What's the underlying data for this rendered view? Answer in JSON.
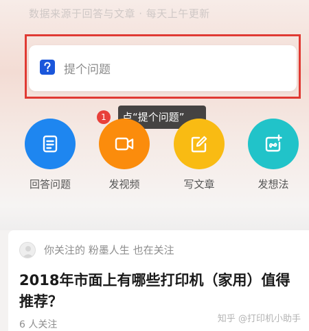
{
  "source_note": "数据来源于回答与文章 · 每天上午更新",
  "ask": {
    "placeholder": "提个问题",
    "icon": "question-mark-icon"
  },
  "callout": {
    "number": "1",
    "text": "点“提个问题”"
  },
  "actions": [
    {
      "label": "回答问题",
      "icon": "answer-doc-icon",
      "color": "#1e86f0"
    },
    {
      "label": "发视频",
      "icon": "video-camera-icon",
      "color": "#fb8c0c"
    },
    {
      "label": "写文章",
      "icon": "pencil-edit-icon",
      "color": "#f9bb13"
    },
    {
      "label": "发想法",
      "icon": "idea-add-icon",
      "color": "#21c3c9"
    }
  ],
  "feed_card": {
    "follow_prefix": "你关注的",
    "follow_user": "粉墨人生",
    "follow_suffix": "也在关注",
    "title": "2018年市面上有哪些打印机（家用）值得推荐？",
    "followers": "6 人关注"
  },
  "watermark": "知乎 @打印机小助手",
  "colors": {
    "highlight_frame": "#e03a33",
    "ask_icon": "#1a56db"
  }
}
